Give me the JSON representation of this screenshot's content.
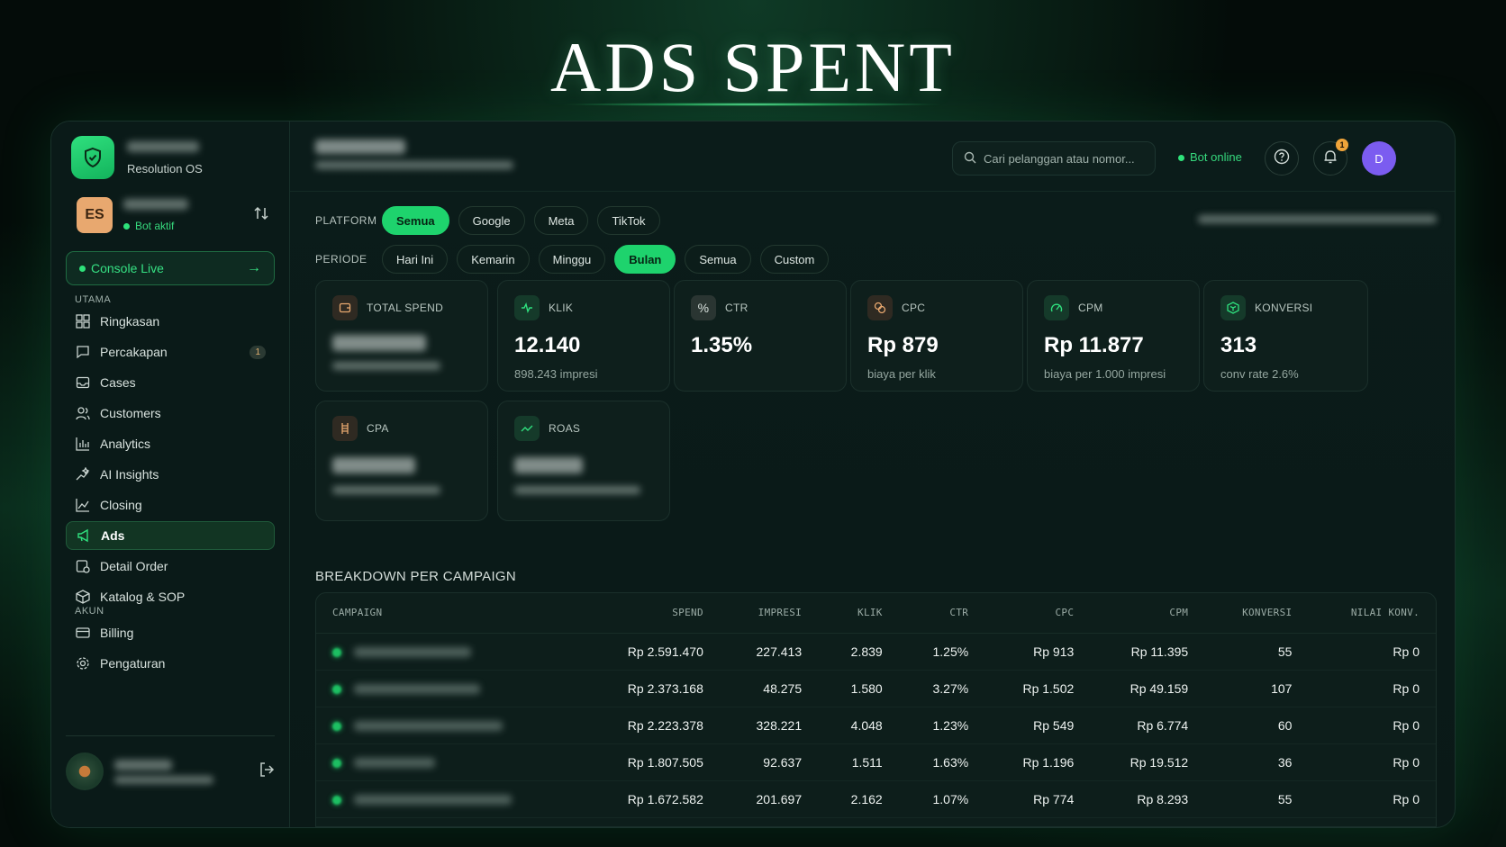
{
  "hero": {
    "title": "ADS SPENT"
  },
  "sidebar": {
    "brand_sub": "Resolution OS",
    "profile_initials": "ES",
    "bot_status": "Bot aktif",
    "console_label": "Console Live",
    "section_main": "UTAMA",
    "section_account": "AKUN",
    "items": [
      {
        "label": "Ringkasan"
      },
      {
        "label": "Percakapan",
        "badge": "1"
      },
      {
        "label": "Cases"
      },
      {
        "label": "Customers"
      },
      {
        "label": "Analytics"
      },
      {
        "label": "AI Insights"
      },
      {
        "label": "Closing"
      },
      {
        "label": "Ads"
      },
      {
        "label": "Detail Order"
      },
      {
        "label": "Katalog & SOP"
      }
    ],
    "account_items": [
      {
        "label": "Billing"
      },
      {
        "label": "Pengaturan"
      }
    ]
  },
  "topbar": {
    "search_placeholder": "Cari pelanggan atau nomor...",
    "bot_online": "Bot online",
    "notif_count": "1",
    "user_initial": "D"
  },
  "filters": {
    "platform_label": "PLATFORM",
    "platforms": [
      "Semua",
      "Google",
      "Meta",
      "TikTok"
    ],
    "platform_active": "Semua",
    "period_label": "PERIODE",
    "periods": [
      "Hari Ini",
      "Kemarin",
      "Minggu",
      "Bulan",
      "Semua",
      "Custom"
    ],
    "period_active": "Bulan"
  },
  "colors": {
    "accent": "#1ed36d",
    "orange": "#e8a86f",
    "purple": "#7b5cf0"
  },
  "cards": {
    "total_spend": {
      "label": "TOTAL SPEND",
      "icon": "wallet-icon"
    },
    "klik": {
      "label": "KLIK",
      "value": "12.140",
      "sub": "898.243 impresi",
      "icon": "pulse-icon"
    },
    "ctr": {
      "label": "CTR",
      "value": "1.35%",
      "icon": "percent-icon"
    },
    "cpc": {
      "label": "CPC",
      "value": "Rp 879",
      "sub": "biaya per klik",
      "icon": "coins-icon"
    },
    "cpm": {
      "label": "CPM",
      "value": "Rp 11.877",
      "sub": "biaya per 1.000 impresi",
      "icon": "gauge-icon"
    },
    "konversi": {
      "label": "KONVERSI",
      "value": "313",
      "sub": "conv rate 2.6%",
      "icon": "cube-icon"
    },
    "cpa": {
      "label": "CPA",
      "icon": "ladder-icon"
    },
    "roas": {
      "label": "ROAS",
      "icon": "trend-icon"
    }
  },
  "breakdown": {
    "title": "BREAKDOWN PER CAMPAIGN",
    "columns": [
      "CAMPAIGN",
      "SPEND",
      "IMPRESI",
      "KLIK",
      "CTR",
      "CPC",
      "CPM",
      "KONVERSI",
      "NILAI KONV."
    ],
    "rows": [
      [
        "Rp 2.591.470",
        "227.413",
        "2.839",
        "1.25%",
        "Rp 913",
        "Rp 11.395",
        "55",
        "Rp 0"
      ],
      [
        "Rp 2.373.168",
        "48.275",
        "1.580",
        "3.27%",
        "Rp 1.502",
        "Rp 49.159",
        "107",
        "Rp 0"
      ],
      [
        "Rp 2.223.378",
        "328.221",
        "4.048",
        "1.23%",
        "Rp 549",
        "Rp 6.774",
        "60",
        "Rp 0"
      ],
      [
        "Rp 1.807.505",
        "92.637",
        "1.511",
        "1.63%",
        "Rp 1.196",
        "Rp 19.512",
        "36",
        "Rp 0"
      ],
      [
        "Rp 1.672.582",
        "201.697",
        "2.162",
        "1.07%",
        "Rp 774",
        "Rp 8.293",
        "55",
        "Rp 0"
      ]
    ]
  }
}
